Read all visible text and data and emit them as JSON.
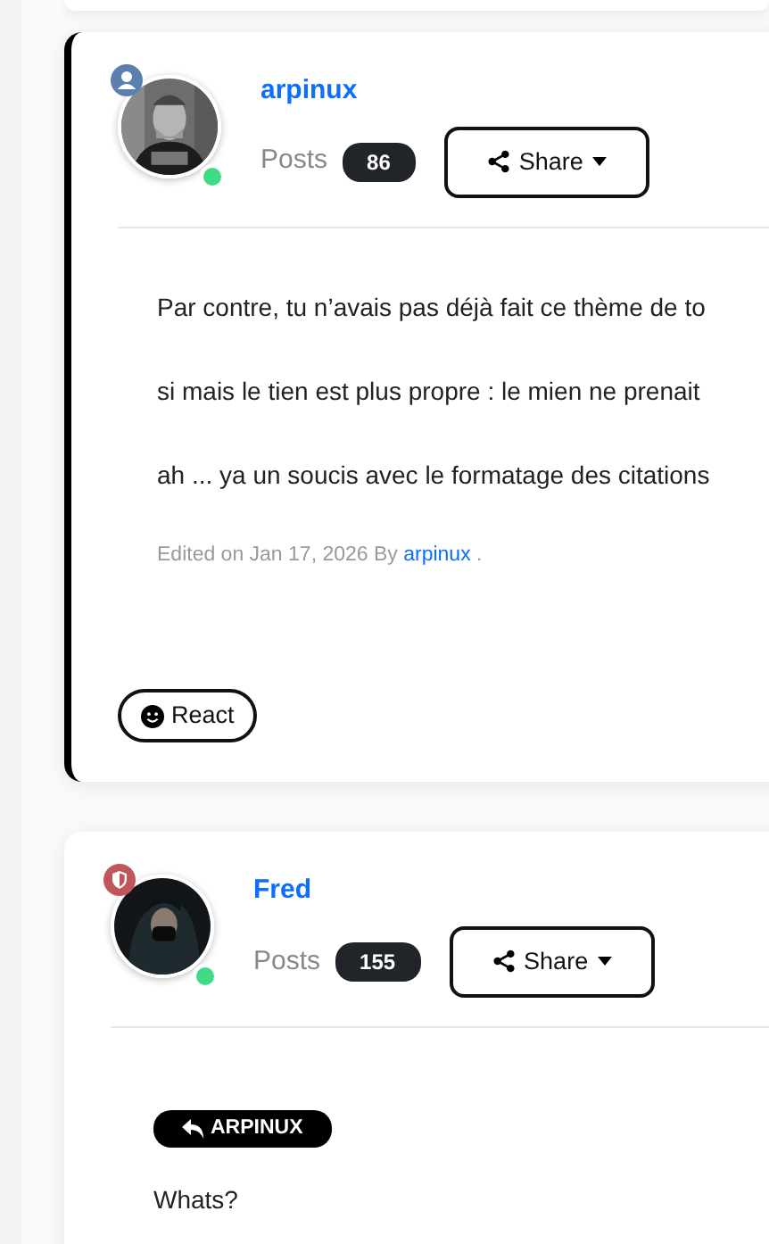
{
  "posts": [
    {
      "highlighted": true,
      "author": "arpinux",
      "rank": {
        "kind": "member"
      },
      "online": true,
      "posts_label": "Posts",
      "post_count": "86",
      "share": "Share",
      "paragraphs": [
        "Par contre, tu n’avais pas déjà fait ce thème de to",
        "si mais le tien est plus propre : le mien ne prenait",
        "ah ... ya un soucis avec le formatage des citations"
      ],
      "edited": {
        "prefix": "Edited on Jan 17, 2026 By",
        "user": "arpinux",
        "suffix": "."
      },
      "react": "React"
    },
    {
      "highlighted": false,
      "author": "Fred",
      "rank": {
        "kind": "moderator"
      },
      "online": true,
      "posts_label": "Posts",
      "post_count": "155",
      "share": "Share",
      "reply_to": "ARPINUX",
      "paragraphs": [
        "Whats?"
      ]
    }
  ]
}
